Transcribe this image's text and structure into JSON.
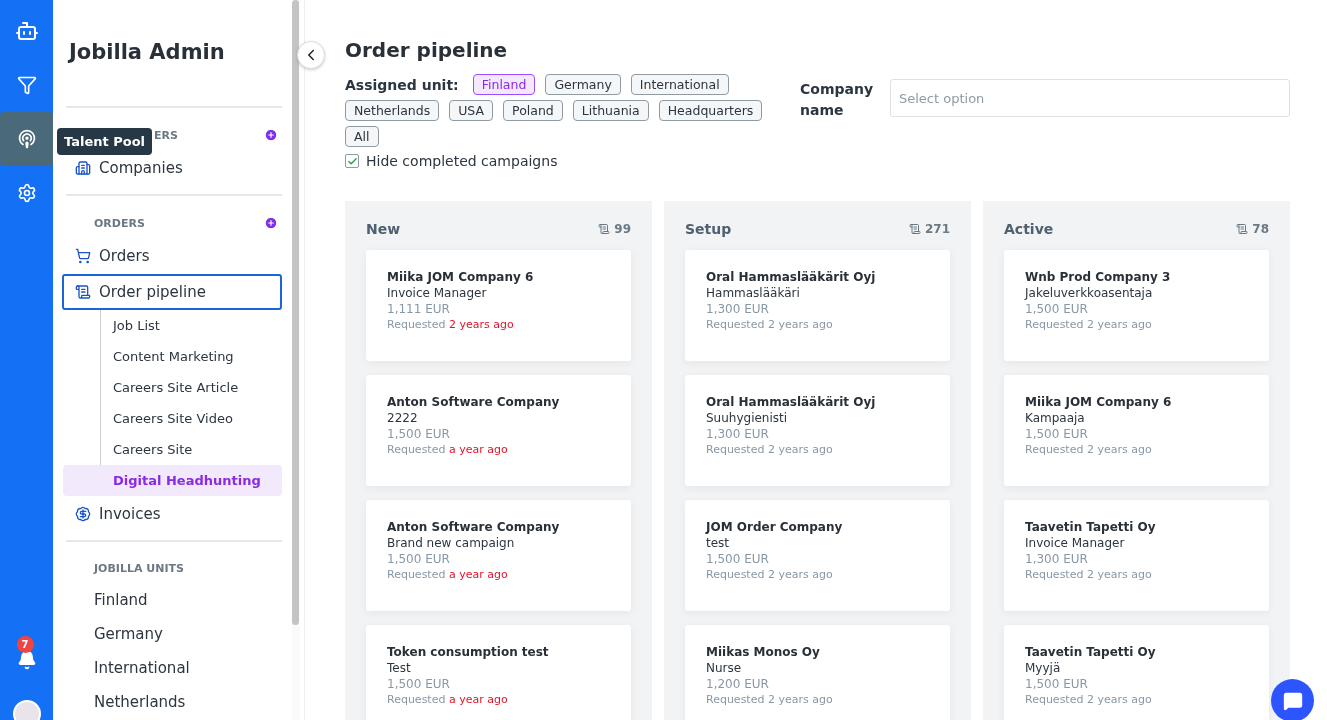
{
  "rail": {
    "items": [
      {
        "kind": "logo",
        "selected": false
      },
      {
        "kind": "filter",
        "selected": false
      },
      {
        "kind": "talent",
        "selected": true
      },
      {
        "kind": "settings",
        "selected": false
      }
    ],
    "tooltip": "Talent Pool",
    "notification_count": "7"
  },
  "sidebar": {
    "title": "Jobilla Admin",
    "sections": [
      {
        "heading": "ERS",
        "add": true,
        "items": [
          {
            "kind": "companies",
            "label": "Companies",
            "selected": false
          }
        ]
      },
      {
        "heading": "ORDERS",
        "add": true,
        "items": [
          {
            "kind": "orders",
            "label": "Orders",
            "selected": false
          },
          {
            "kind": "pipeline",
            "label": "Order pipeline",
            "selected": true,
            "children": [
              {
                "label": "Job List",
                "selected": false
              },
              {
                "label": "Content Marketing",
                "selected": false
              },
              {
                "label": "Careers Site Article",
                "selected": false
              },
              {
                "label": "Careers Site Video",
                "selected": false
              },
              {
                "label": "Careers Site",
                "selected": false
              },
              {
                "label": "Digital Headhunting",
                "selected": true
              }
            ]
          },
          {
            "kind": "invoices",
            "label": "Invoices",
            "selected": false
          }
        ]
      },
      {
        "heading": "JOBILLA UNITS",
        "add": false,
        "items": [
          {
            "kind": "plain",
            "label": "Finland"
          },
          {
            "kind": "plain",
            "label": "Germany"
          },
          {
            "kind": "plain",
            "label": "International"
          },
          {
            "kind": "plain",
            "label": "Netherlands"
          }
        ]
      }
    ]
  },
  "page": {
    "title": "Order pipeline",
    "unit_label": "Assigned unit:",
    "units": [
      {
        "label": "Finland",
        "selected": true
      },
      {
        "label": "Germany",
        "selected": false
      },
      {
        "label": "International",
        "selected": false
      },
      {
        "label": "Netherlands",
        "selected": false
      },
      {
        "label": "USA",
        "selected": false
      },
      {
        "label": "Poland",
        "selected": false
      },
      {
        "label": "Lithuania",
        "selected": false
      },
      {
        "label": "Headquarters",
        "selected": false
      },
      {
        "label": "All",
        "selected": false
      }
    ],
    "hide_completed": {
      "label": "Hide completed campaigns",
      "checked": true
    },
    "company_field": {
      "label": "Company name",
      "placeholder": "Select option"
    }
  },
  "board": {
    "columns": [
      {
        "title": "New",
        "count": "99",
        "cards": [
          {
            "company": "Miika JOM Company 6",
            "role": "Invoice Manager",
            "price": "1,111 EUR",
            "requested": "Requested",
            "age": "2 years ago",
            "overdue": true
          },
          {
            "company": "Anton Software Company",
            "role": "2222",
            "price": "1,500 EUR",
            "requested": "Requested",
            "age": "a year ago",
            "overdue": true
          },
          {
            "company": "Anton Software Company",
            "role": "Brand new campaign",
            "price": "1,500 EUR",
            "requested": "Requested",
            "age": "a year ago",
            "overdue": true
          },
          {
            "company": "Token consumption test",
            "role": "Test",
            "price": "1,500 EUR",
            "requested": "Requested",
            "age": "a year ago",
            "overdue": true
          }
        ]
      },
      {
        "title": "Setup",
        "count": "271",
        "cards": [
          {
            "company": "Oral Hammaslääkärit Oyj",
            "role": "Hammaslääkäri",
            "price": "1,300 EUR",
            "requested": "Requested",
            "age": "2 years ago",
            "overdue": false
          },
          {
            "company": "Oral Hammaslääkärit Oyj",
            "role": "Suuhygienisti",
            "price": "1,300 EUR",
            "requested": "Requested",
            "age": "2 years ago",
            "overdue": false
          },
          {
            "company": "JOM Order Company",
            "role": "test",
            "price": "1,500 EUR",
            "requested": "Requested",
            "age": "2 years ago",
            "overdue": false
          },
          {
            "company": "Miikas Monos Oy",
            "role": "Nurse",
            "price": "1,200 EUR",
            "requested": "Requested",
            "age": "2 years ago",
            "overdue": false
          }
        ]
      },
      {
        "title": "Active",
        "count": "78",
        "cards": [
          {
            "company": "Wnb Prod Company 3",
            "role": "Jakeluverkkoasentaja",
            "price": "1,500 EUR",
            "requested": "Requested",
            "age": "2 years ago",
            "overdue": false
          },
          {
            "company": "Miika JOM Company 6",
            "role": "Kampaaja",
            "price": "1,500 EUR",
            "requested": "Requested",
            "age": "2 years ago",
            "overdue": false
          },
          {
            "company": "Taavetin Tapetti Oy",
            "role": "Invoice Manager",
            "price": "1,300 EUR",
            "requested": "Requested",
            "age": "2 years ago",
            "overdue": false
          },
          {
            "company": "Taavetin Tapetti Oy",
            "role": "Myyjä",
            "price": "1,500 EUR",
            "requested": "Requested",
            "age": "2 years ago",
            "overdue": false
          }
        ]
      }
    ]
  }
}
